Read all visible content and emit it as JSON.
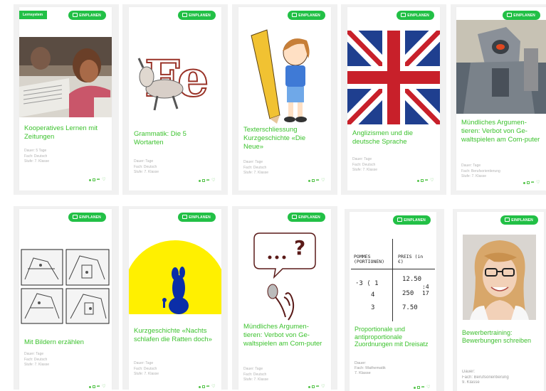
{
  "common": {
    "button_label": "EINPLANEN",
    "badge_label": "Lernsystem",
    "dauer_label": "Dauer:",
    "fach_label": "Fach:",
    "stufe_label": "Stufe:"
  },
  "cards": [
    {
      "title": "Kooperatives Lernen mit Zeitungen",
      "dauer": "Dauer: 5 Tage",
      "fach": "Fach: Deutsch",
      "stufe": "Stufe: 7. Klasse",
      "image": "newspaper-reader-photo"
    },
    {
      "title": "Grammatik: Die 5 Wortarten",
      "dauer": "Dauer: Tage",
      "fach": "Fach: Deutsch",
      "stufe": "Stufe: 7. Klasse",
      "image": "donkey-letters-drawing"
    },
    {
      "title": "Texterschliessung Kurzgeschichte «Die Neue»",
      "dauer": "Dauer: Tage",
      "fach": "Fach: Deutsch",
      "stufe": "Stufe: 7. Klasse",
      "image": "girl-pencil-cartoon"
    },
    {
      "title": "Anglizismen und die deutsche Sprache",
      "dauer": "Dauer: Tage",
      "fach": "Fach: Deutsch",
      "stufe": "Stufe: 7. Klasse",
      "image": "union-jack-flag"
    },
    {
      "title": "Mündliches Argumen-tieren: Verbot von Ge-waltspielen am Com-puter",
      "dauer": "Dauer: Tage",
      "fach": "Fach: Berufsorientierung",
      "stufe": "Stufe: 7. Klasse",
      "image": "robot-game-screenshot"
    },
    {
      "title": "Mit Bildern erzählen",
      "dauer": "Dauer: Tage",
      "fach": "Fach: Deutsch",
      "stufe": "Stufe: 7. Klasse",
      "image": "comic-strip-panels"
    },
    {
      "title": "Kurzgeschichte «Nachts schlafen die Ratten doch»",
      "dauer": "Dauer: Tage",
      "fach": "Fach: Deutsch",
      "stufe": "Stufe: 7. Klasse",
      "image": "yellow-moon-rabbit"
    },
    {
      "title": "Mündliches Argumen-tieren: Verbot von Ge-waltspielen am Com-puter",
      "dauer": "Dauer: Tage",
      "fach": "Fach: Deutsch",
      "stufe": "Stufe: 7. Klasse",
      "image": "microphone-speech-bubble"
    },
    {
      "title": "Proportionale und antiproportionale Zuordnungen mit Dreisatz",
      "dauer": "Dauer:",
      "fach": "Fach: Mathematik",
      "stufe": "7. Klasse",
      "image": "handwritten-table",
      "table": {
        "col1": "POMMES (PORTIONEN)",
        "col2": "PREIS (in €)",
        "r1a": "·3 ⟨ 1",
        "r1b": "12.50",
        "r2a": "4",
        "r2b": "250",
        "r3a": "3",
        "r3b": "7.50",
        "note": ":4 17"
      }
    },
    {
      "title": "Bewerbertraining: Bewerbungen schreiben",
      "dauer": "Dauer:",
      "fach": "Fach: Berufsorientierung",
      "stufe": "9. Klasse",
      "image": "woman-portrait-photo"
    }
  ]
}
